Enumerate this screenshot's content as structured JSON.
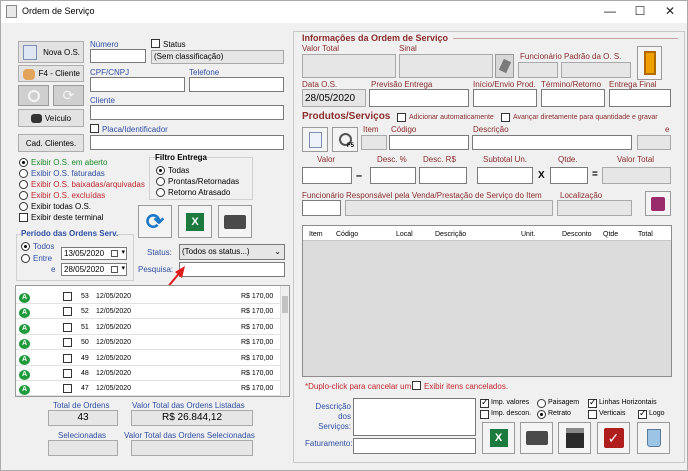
{
  "window": {
    "title": "Ordem de Serviço",
    "minimize": "—",
    "maximize": "☐",
    "close": "✕"
  },
  "left": {
    "nova_os": "Nova O.S.",
    "f4_cliente": "F4 - Cliente",
    "veiculo": "Veículo",
    "cad_clientes": "Cad. Clientes.",
    "numero_label": "Número",
    "status_label": "Status",
    "status_value": "(Sem classificação)",
    "cpf_label": "CPF/CNPJ",
    "telefone_label": "Telefone",
    "cliente_label": "Cliente",
    "placa_label": "Placa/Identificador",
    "filters": [
      {
        "label": "Exibir O.S. em aberto",
        "color": "#1c8a2a",
        "checked": true
      },
      {
        "label": "Exibir O.S. faturadas",
        "color": "#2e4fa3",
        "checked": false
      },
      {
        "label": "Exibir O.S. baixadas/arquivadas",
        "color": "#c0282d",
        "checked": false
      },
      {
        "label": "Exibir O.S. excluídas",
        "color": "#c0282d",
        "checked": false
      },
      {
        "label": "Exibir todas O.S.",
        "color": "#000000",
        "checked": false
      }
    ],
    "exibir_terminal": "Exibir deste terminal",
    "filtro_entrega_title": "Filtro Entrega",
    "filtro_entrega": [
      "Todas",
      "Prontas/Retornadas",
      "Retorno Atrasado"
    ],
    "periodo_title": "Período das Ordens Serv.",
    "periodo_todos": "Todos",
    "periodo_entre": "Entre",
    "periodo_e": "e",
    "date_from": "13/05/2020",
    "date_to": "28/05/2020",
    "status_filter_label": "Status:",
    "status_filter_value": "(Todos os status...)",
    "pesquisa_label": "Pesquisa:",
    "rows": [
      {
        "num": "53",
        "date": "12/05/2020",
        "value": "R$ 170,00"
      },
      {
        "num": "52",
        "date": "12/05/2020",
        "value": "R$ 170,00"
      },
      {
        "num": "51",
        "date": "12/05/2020",
        "value": "R$ 170,00"
      },
      {
        "num": "50",
        "date": "12/05/2020",
        "value": "R$ 170,00"
      },
      {
        "num": "49",
        "date": "12/05/2020",
        "value": "R$ 170,00"
      },
      {
        "num": "48",
        "date": "12/05/2020",
        "value": "R$ 170,00"
      },
      {
        "num": "47",
        "date": "12/05/2020",
        "value": "R$ 170,00"
      }
    ],
    "total_ordens_label": "Total de Ordens",
    "total_ordens_value": "43",
    "valor_total_label": "Valor Total das Ordens Listadas",
    "valor_total_value": "R$ 26.844,12",
    "selecionadas_label": "Selecionadas",
    "valor_sel_label": "Valor Total das Ordens Selecionadas"
  },
  "right": {
    "info_title": "Informações da Ordem de Serviço",
    "valor_total_label": "Valor Total",
    "sinal_label": "Sinal",
    "funcionario_padrao_label": "Funcionário Padrão da O. S.",
    "data_os_label": "Data O.S.",
    "data_os_value": "28/05/2020",
    "previsao_label": "Previsão Entrega",
    "inicio_label": "Início/Envio Prod.",
    "termino_label": "Término/Retorno",
    "entrega_final_label": "Entrega Final",
    "produtos_title": "Produtos/Serviços",
    "adicionar_auto": "Adicionar automaticamente",
    "avancar": "Avançar diretamente para quantidade e gravar",
    "item_label": "Item",
    "codigo_label": "Código",
    "descricao_label": "Descrição",
    "e_label": "e",
    "valor_label": "Valor",
    "desc_pct_label": "Desc. %",
    "desc_rs_label": "Desc. R$",
    "subtotal_label": "Subtotal Un.",
    "qtde_label": "Qtde.",
    "valor_total2_label": "Valor Total",
    "dash": "–",
    "times": "X",
    "equals": "=",
    "func_resp_label": "Funcionário Responsável pela Venda/Prestação de Serviço do Item",
    "localizacao_label": "Localização",
    "table_headers": [
      "Item",
      "Código",
      "Local",
      "Descrição",
      "Unit.",
      "Desconto",
      "Qtde",
      "Total"
    ],
    "duplo_click": "*Duplo-click para cancelar um",
    "exibir_cancelados": "Exibir itens cancelados.",
    "descricao_servicos_label": "Descrição dos Serviços:",
    "faturamento_label": "Faturamento:",
    "print_opts": [
      {
        "label": "Imp. valores",
        "type": "check",
        "on": true
      },
      {
        "label": "Paisagem",
        "type": "radio",
        "on": false
      },
      {
        "label": "Linhas Horizontais",
        "type": "check",
        "on": true
      },
      {
        "label": "Imp. descon.",
        "type": "check",
        "on": false
      },
      {
        "label": "Retrato",
        "type": "radio",
        "on": true
      },
      {
        "label": "Verticais",
        "type": "check",
        "on": false
      },
      {
        "label": "Logo",
        "type": "check",
        "on": true
      }
    ]
  }
}
